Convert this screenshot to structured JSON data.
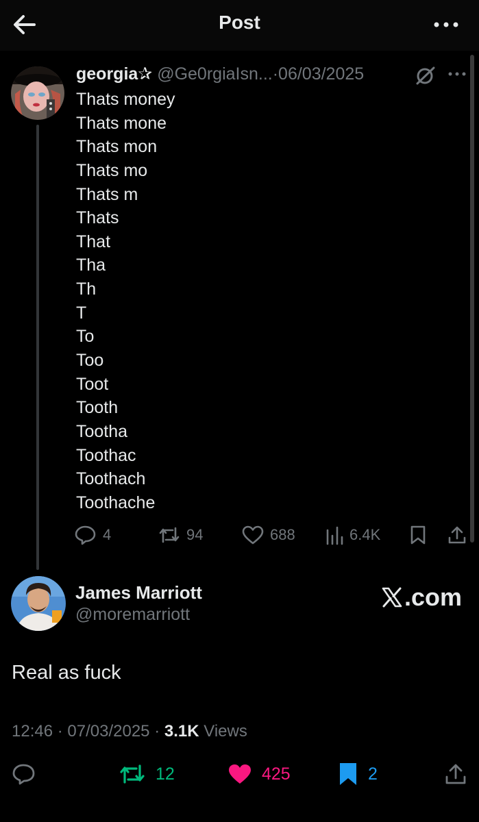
{
  "header": {
    "title": "Post",
    "back_icon": "arrow-left-icon",
    "more_icon": "more-horizontal-icon"
  },
  "quoted_post": {
    "author_name": "georgia",
    "author_badge": "✰",
    "handle": "@Ge0rgiaIsn...",
    "separator": "·",
    "date": "06/03/2025",
    "lines": [
      "Thats money",
      "Thats mone",
      "Thats mon",
      "Thats mo",
      "Thats m",
      "Thats",
      "That",
      "Tha",
      "Th",
      "T",
      "To",
      "Too",
      "Toot",
      "Tooth",
      "Tootha",
      "Toothac",
      "Toothach",
      "Toothache"
    ],
    "replies": "4",
    "reposts": "94",
    "likes": "688",
    "views": "6.4K"
  },
  "main_post": {
    "author_name": "James Marriott",
    "handle": "@moremarriott",
    "watermark": ".com",
    "text": "Real as fuck",
    "time": "12:46",
    "separator": "·",
    "date": "07/03/2025",
    "separator2": "·",
    "views_count": "3.1K",
    "views_label": "Views",
    "reposts": "12",
    "likes": "425",
    "bookmarks": "2"
  },
  "colors": {
    "background": "#000000",
    "text": "#e7e9ea",
    "muted": "#71767b",
    "repost_green": "#00ba7c",
    "like_pink": "#f91880",
    "bookmark_blue": "#1d9bf0"
  }
}
